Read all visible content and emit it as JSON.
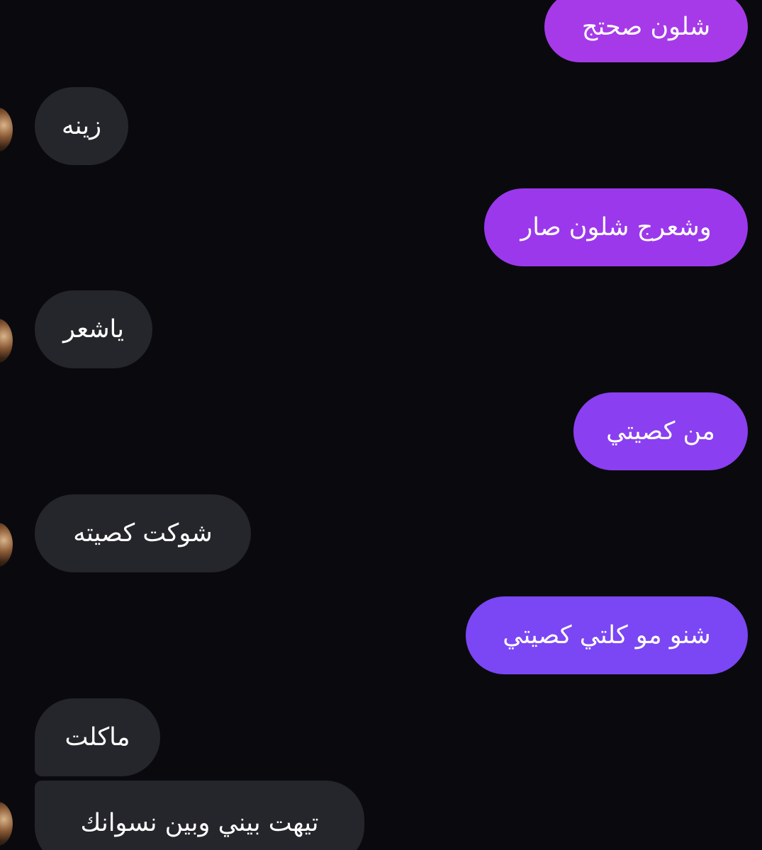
{
  "conversation": {
    "messages": [
      {
        "side": "outgoing",
        "text": "شلون صحتج",
        "color": "#a63ae8"
      },
      {
        "side": "incoming",
        "text": "زينه",
        "color": "#25262b"
      },
      {
        "side": "outgoing",
        "text": "وشعرج شلون صار",
        "color": "#9b38ec"
      },
      {
        "side": "incoming",
        "text": "ياشعر",
        "color": "#25262b"
      },
      {
        "side": "outgoing",
        "text": "من كصيتي",
        "color": "#8a3ff0"
      },
      {
        "side": "incoming",
        "text": "شوكت كصيته",
        "color": "#25262b"
      },
      {
        "side": "outgoing",
        "text": "شنو مو كلتي كصيتي",
        "color": "#7b46f4"
      },
      {
        "side": "incoming",
        "text": "ماكلت",
        "color": "#25262b"
      },
      {
        "side": "incoming",
        "text": "تيهت بيني وبين نسوانك",
        "color": "#25262b"
      }
    ]
  }
}
